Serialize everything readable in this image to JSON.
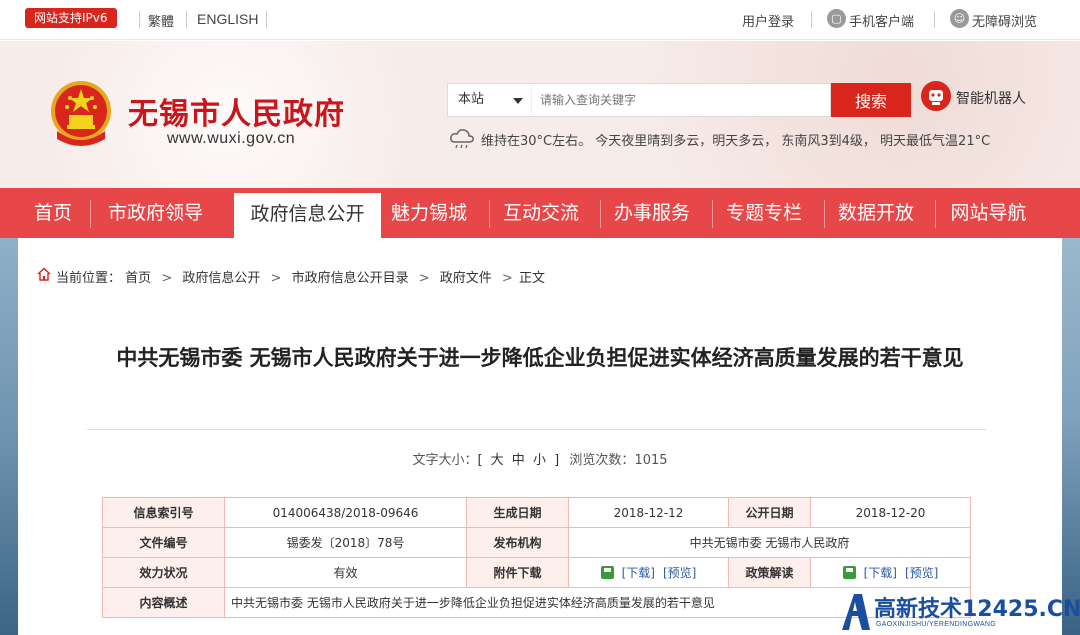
{
  "topbar": {
    "ipv6_badge": "网站支持IPv6",
    "traditional": "繁體",
    "english": "ENGLISH",
    "login": "用户登录",
    "mobile": "手机客户端",
    "accessible": "无障碍浏览"
  },
  "header": {
    "title": "无锡市人民政府",
    "domain": "www.wuxi.gov.cn",
    "search_scope": "本站",
    "search_placeholder": "请输入查询关键字",
    "search_button": "搜索",
    "robot_label": "智能机器人",
    "weather": "维持在30°C左右。   今天夜里晴到多云，明天多云，  东南风3到4级，  明天最低气温21°C"
  },
  "nav": {
    "items": [
      "首页",
      "市政府领导",
      "政府信息公开",
      "魅力锡城",
      "互动交流",
      "办事服务",
      "专题专栏",
      "数据开放",
      "网站导航"
    ],
    "active_index": 2
  },
  "breadcrumb": {
    "prefix": "当前位置：",
    "items": [
      "首页",
      "政府信息公开",
      "市政府信息公开目录",
      "政府文件",
      "正文"
    ]
  },
  "document": {
    "title": "中共无锡市委 无锡市人民政府关于进一步降低企业负担促进实体经济高质量发展的若干意见",
    "font_size_label": "文字大小：",
    "font_size_options": "[ 大 中 小 ]",
    "views_label": "浏览次数：",
    "views": "1015"
  },
  "info_table": {
    "index_label": "信息索引号",
    "index_value": "014006438/2018-09646",
    "gen_date_label": "生成日期",
    "gen_date_value": "2018-12-12",
    "pub_date_label": "公开日期",
    "pub_date_value": "2018-12-20",
    "doc_no_label": "文件编号",
    "doc_no_value": "锡委发〔2018〕78号",
    "issuer_label": "发布机构",
    "issuer_value": "中共无锡市委 无锡市人民政府",
    "status_label": "效力状况",
    "status_value": "有效",
    "attach_label": "附件下载",
    "download_label": "[下载]",
    "preview_label": "[预览]",
    "policy_label": "政策解读",
    "summary_label": "内容概述",
    "summary_value": "中共无锡市委 无锡市人民政府关于进一步降低企业负担促进实体经济高质量发展的若干意见"
  },
  "watermark": {
    "text": "高新技术12425.CN",
    "sub": "GAOXINJISHU/YERENDINGWANG"
  },
  "colors": {
    "brand_red": "#d9261c",
    "nav_red": "#e8474a",
    "table_border": "#f2b9b1",
    "link_blue": "#2a5aa8"
  }
}
